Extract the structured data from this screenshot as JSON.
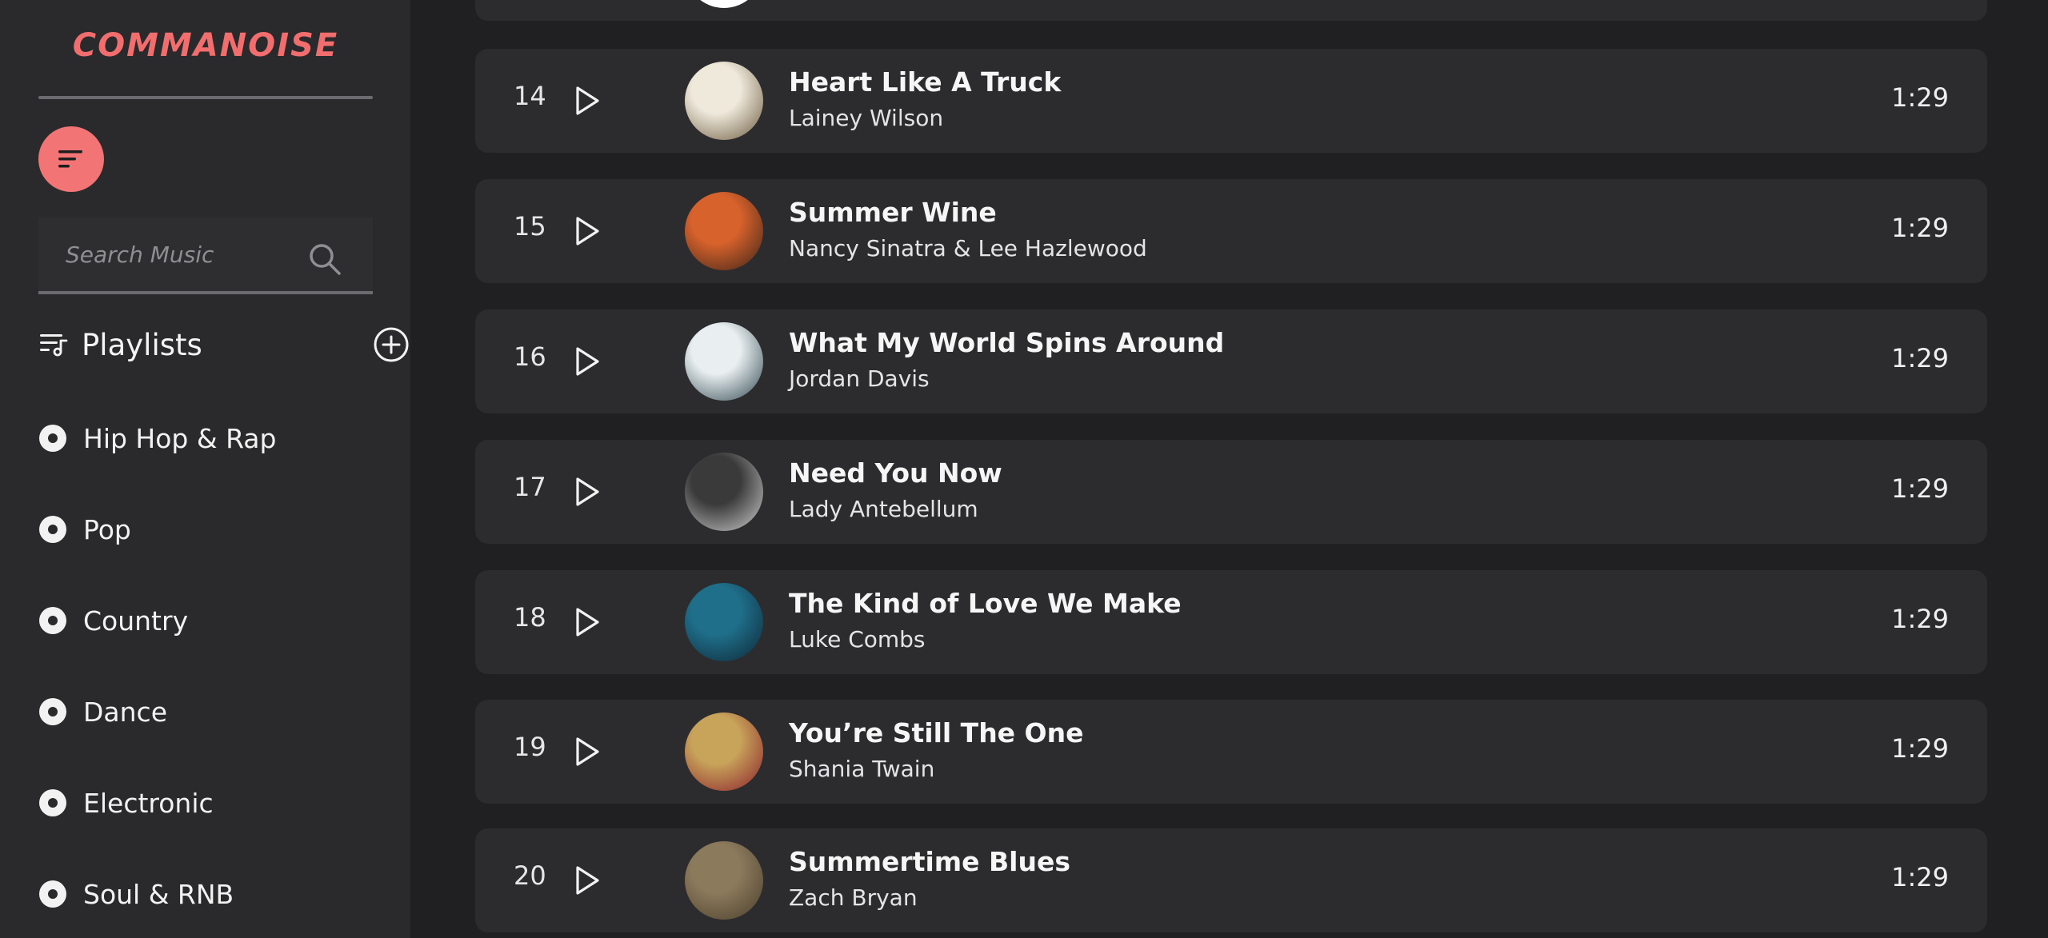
{
  "app": {
    "logo_text": "COMMANOISE"
  },
  "search": {
    "placeholder": "Search Music"
  },
  "playlists": {
    "heading": "Playlists",
    "genres": [
      {
        "label": "Hip Hop & Rap"
      },
      {
        "label": "Pop"
      },
      {
        "label": "Country"
      },
      {
        "label": "Dance"
      },
      {
        "label": "Electronic"
      },
      {
        "label": "Soul & RNB"
      }
    ]
  },
  "tracks": [
    {
      "number": "14",
      "title": "Heart Like A Truck",
      "artist": "Lainey Wilson",
      "duration": "1:29",
      "art_colors": [
        "#efe9dc",
        "#6b5a3e"
      ]
    },
    {
      "number": "15",
      "title": "Summer Wine",
      "artist": "Nancy Sinatra & Lee Hazlewood",
      "duration": "1:29",
      "art_colors": [
        "#d8622c",
        "#3b2418"
      ]
    },
    {
      "number": "16",
      "title": "What My World Spins Around",
      "artist": "Jordan Davis",
      "duration": "1:29",
      "art_colors": [
        "#e9eef0",
        "#2f4850"
      ]
    },
    {
      "number": "17",
      "title": "Need You Now",
      "artist": "Lady Antebellum",
      "duration": "1:29",
      "art_colors": [
        "#3a3a3a",
        "#cfcfcf"
      ]
    },
    {
      "number": "18",
      "title": "The Kind of Love We Make",
      "artist": "Luke Combs",
      "duration": "1:29",
      "art_colors": [
        "#1f6f8b",
        "#0e2634"
      ]
    },
    {
      "number": "19",
      "title": "You’re Still The One",
      "artist": "Shania Twain",
      "duration": "1:29",
      "art_colors": [
        "#c8a35a",
        "#8a1f2b"
      ]
    },
    {
      "number": "20",
      "title": "Summertime Blues",
      "artist": "Zach Bryan",
      "duration": "1:29",
      "art_colors": [
        "#8c7a5c",
        "#4a3e2c"
      ]
    }
  ],
  "colors": {
    "accent": "#f27474",
    "background": "#202022",
    "sidebar": "#2a2a2c",
    "row": "#2c2c2f"
  },
  "icons": {
    "menu": "menu-lines-icon",
    "search": "search-icon",
    "playlist": "playlist-icon",
    "add": "plus-circle-icon",
    "genre": "disc-icon",
    "play": "play-icon"
  }
}
